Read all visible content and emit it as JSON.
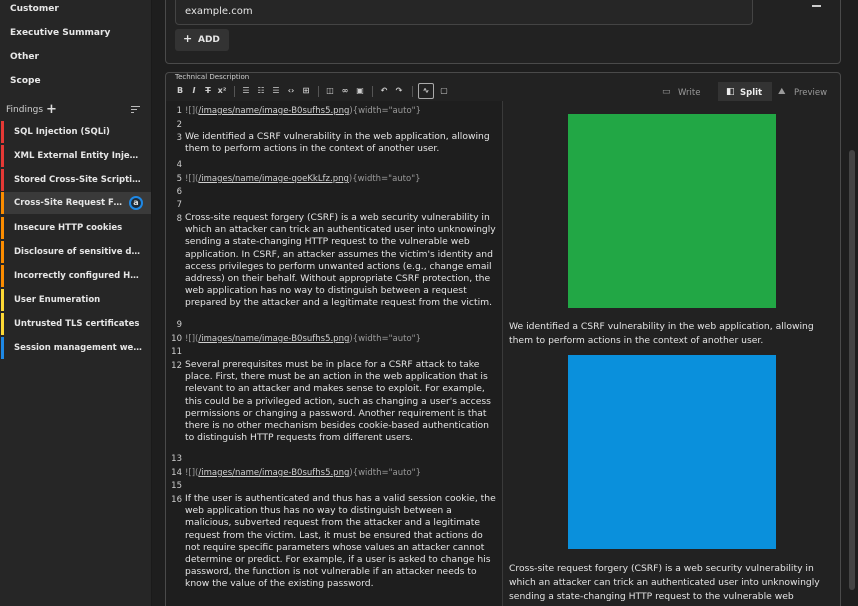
{
  "sidebar": {
    "nav": [
      {
        "label": "Customer"
      },
      {
        "label": "Executive Summary"
      },
      {
        "label": "Other"
      },
      {
        "label": "Scope"
      }
    ],
    "findings_label": "Findings",
    "findings": [
      {
        "label": "SQL Injection (SQLi)",
        "color": "#e53935"
      },
      {
        "label": "XML External Entity Injection ...",
        "color": "#e53935"
      },
      {
        "label": "Stored Cross-Site Scripting (X...",
        "color": "#e53935"
      },
      {
        "label": "Cross-Site Request Forger...",
        "color": "#fb8c00",
        "badge": "a"
      },
      {
        "label": "Insecure HTTP cookies",
        "color": "#fb8c00"
      },
      {
        "label": "Disclosure of sensitive data i...",
        "color": "#fb8c00"
      },
      {
        "label": "Incorrectly configured HTTP s...",
        "color": "#fb8c00"
      },
      {
        "label": "User Enumeration",
        "color": "#fdd835"
      },
      {
        "label": "Untrusted TLS certificates",
        "color": "#fdd835"
      },
      {
        "label": "Session management weakn...",
        "color": "#1e88e5"
      }
    ]
  },
  "top_card": {
    "input_value": "example.com",
    "add_label": "ADD"
  },
  "editor": {
    "label": "Technical Description",
    "toolbar": {
      "bold": "B",
      "italic": "I",
      "strike": "T",
      "superscript": "x²"
    },
    "modes": [
      {
        "label": "Write",
        "icon": "▭"
      },
      {
        "label": "Split",
        "icon": "◧"
      },
      {
        "label": "Preview",
        "icon": "⛰"
      }
    ],
    "source_lines": [
      {
        "n": "1",
        "md": true,
        "prefix": "![](",
        "link": "/images/name/image-B0sufhs5.png",
        "suffix": "){width=\"auto\"}"
      },
      {
        "n": "2"
      },
      {
        "n": "3",
        "text": "We identified a CSRF vulnerability in the web application, allowing them to perform actions in the context of another user."
      },
      {
        "n": "4"
      },
      {
        "n": "5",
        "md": true,
        "prefix": "![](",
        "link": "/images/name/image-qoeKkLfz.png",
        "suffix": "){width=\"auto\"}"
      },
      {
        "n": "6"
      },
      {
        "n": "7"
      },
      {
        "n": "8",
        "text": "Cross-site request forgery (CSRF) is a web security vulnerability in which an attacker can trick an authenticated user into unknowingly sending a state-changing HTTP request to the vulnerable web application. In CSRF, an attacker assumes the victim's identity and access privileges to perform unwanted actions (e.g., change email address) on their behalf. Without appropriate CSRF protection, the web application has no way to distinguish between a request prepared by the attacker and a legitimate request from the victim."
      },
      {
        "n": "9"
      },
      {
        "n": "10",
        "md": true,
        "prefix": "![](",
        "link": "/images/name/image-B0sufhs5.png",
        "suffix": "){width=\"auto\"}"
      },
      {
        "n": "11"
      },
      {
        "n": "12",
        "text": "Several prerequisites must be in place for a CSRF attack to take place. First, there must be an action in the web application that is relevant to an attacker and makes sense to exploit. For example, this could be a privileged action, such as changing a user's access permissions or changing a password. Another requirement is that there is no other mechanism besides cookie-based authentication to distinguish HTTP requests from different users."
      },
      {
        "n": "13"
      },
      {
        "n": "14",
        "md": true,
        "prefix": "![](",
        "link": "/images/name/image-B0sufhs5.png",
        "suffix": "){width=\"auto\"}"
      },
      {
        "n": "15"
      },
      {
        "n": "16",
        "text": "If the user is authenticated and thus has a valid session cookie, the web application thus has no way to distinguish between a malicious, subverted request from the attacker and a legitimate request from the victim. Last, it must be ensured that actions do not require specific parameters whose values an attacker cannot determine or predict. For example, if a user is asked to change his password, the function is not vulnerable if an attacker needs to know the value of the existing password."
      }
    ],
    "preview": {
      "image1_color": "#22a745",
      "text1": "We identified a CSRF vulnerability in the web application, allowing them to perform actions in the context of another user.",
      "image2_color": "#0a90dc",
      "text2": "Cross-site request forgery (CSRF) is a web security vulnerability in which an attacker can trick an authenticated user into unknowingly sending a state-changing HTTP request to the vulnerable web"
    }
  }
}
